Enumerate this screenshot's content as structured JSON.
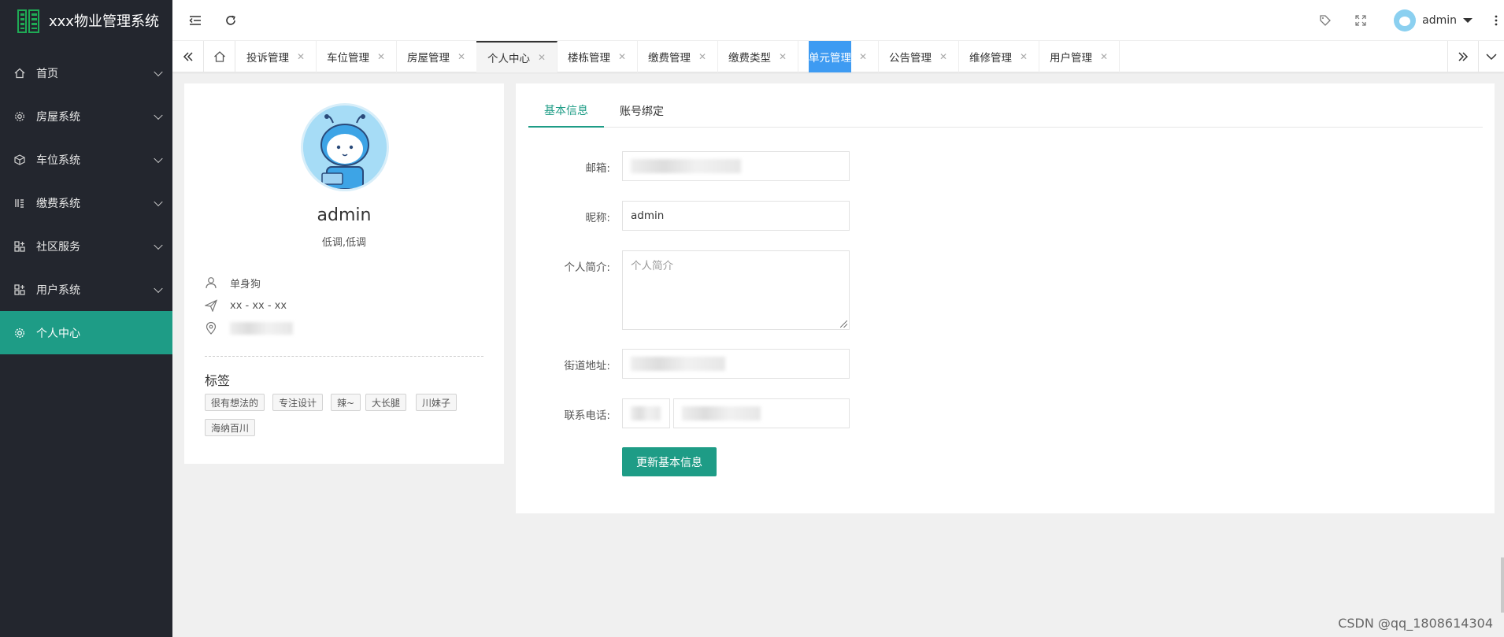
{
  "app": {
    "title": "xxx物业管理系统"
  },
  "sidebar": {
    "items": [
      {
        "label": "首页",
        "icon": "home-icon"
      },
      {
        "label": "房屋系统",
        "icon": "gear-icon"
      },
      {
        "label": "车位系统",
        "icon": "cube-icon"
      },
      {
        "label": "缴费系统",
        "icon": "ledger-icon"
      },
      {
        "label": "社区服务",
        "icon": "apps-icon"
      },
      {
        "label": "用户系统",
        "icon": "apps-icon"
      },
      {
        "label": "个人中心",
        "icon": "gear-icon",
        "active": true
      }
    ]
  },
  "header": {
    "username": "admin"
  },
  "tabs": [
    {
      "label": "投诉管理"
    },
    {
      "label": "车位管理"
    },
    {
      "label": "房屋管理"
    },
    {
      "label": "个人中心",
      "current": true
    },
    {
      "label": "楼栋管理"
    },
    {
      "label": "缴费管理"
    },
    {
      "label": "缴费类型"
    },
    {
      "label": "单元管理",
      "highlight": true
    },
    {
      "label": "公告管理"
    },
    {
      "label": "维修管理"
    },
    {
      "label": "用户管理"
    }
  ],
  "profile": {
    "name": "admin",
    "signature": "低调,低调",
    "role": "单身狗",
    "birthday": "xx - xx - xx",
    "tags_title": "标签",
    "tags": [
      "很有想法的",
      "专注设计",
      "辣~",
      "大长腿",
      "川妹子",
      "海纳百川"
    ]
  },
  "form": {
    "tabs": [
      "基本信息",
      "账号绑定"
    ],
    "email_label": "邮箱:",
    "nickname_label": "昵称:",
    "nickname_value": "admin",
    "bio_label": "个人简介:",
    "bio_placeholder": "个人简介",
    "address_label": "街道地址:",
    "phone_label": "联系电话:",
    "submit_label": "更新基本信息"
  },
  "watermark": "CSDN @qq_1808614304",
  "colors": {
    "accent": "#1e9c86",
    "sidebar_bg": "#23262e",
    "tab_highlight": "#3e9bf2"
  }
}
